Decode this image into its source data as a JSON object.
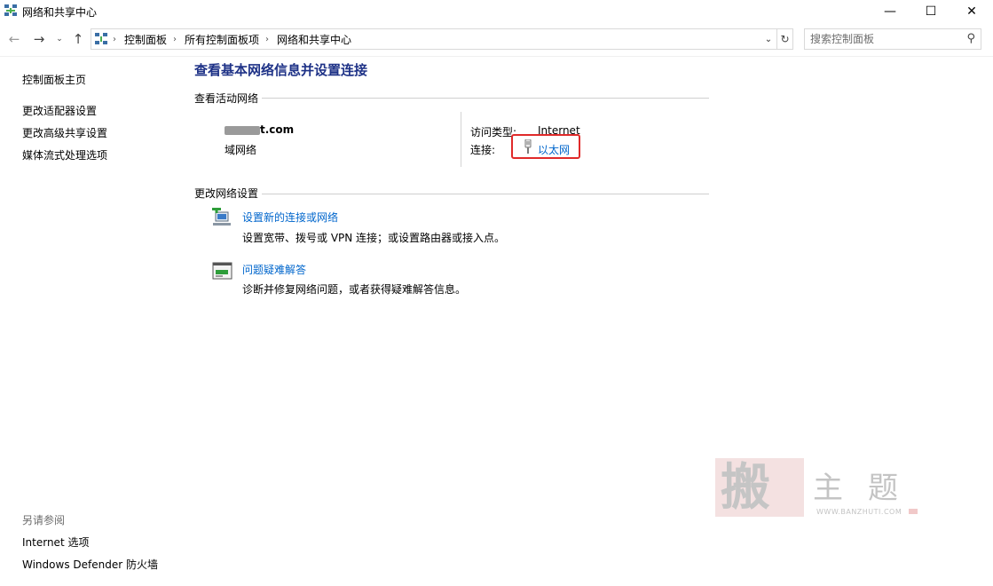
{
  "window": {
    "title": "网络和共享中心",
    "minimize_glyph": "—",
    "maximize_glyph": "☐",
    "close_glyph": "✕"
  },
  "addressbar": {
    "crumbs": [
      "控制面板",
      "所有控制面板项",
      "网络和共享中心"
    ],
    "search_placeholder": "搜索控制面板"
  },
  "leftnav": {
    "items": [
      {
        "label": "控制面板主页"
      },
      {
        "label": "更改适配器设置"
      },
      {
        "label": "更改高级共享设置"
      },
      {
        "label": "媒体流式处理选项"
      }
    ],
    "see_also_heading": "另请参阅",
    "see_also": [
      {
        "label": "Internet 选项"
      },
      {
        "label": "Windows Defender 防火墙"
      }
    ]
  },
  "main": {
    "title": "查看基本网络信息并设置连接",
    "active_networks_heading": "查看活动网络",
    "network": {
      "name_suffix": "t.com",
      "type": "域网络",
      "access_type_label": "访问类型:",
      "access_type_value": "Internet",
      "connections_label": "连接:",
      "connection_name": "以太网"
    },
    "change_settings_heading": "更改网络设置",
    "tasks": [
      {
        "title": "设置新的连接或网络",
        "description": "设置宽带、拨号或 VPN 连接；或设置路由器或接入点。",
        "icon": "new-connection-icon"
      },
      {
        "title": "问题疑难解答",
        "description": "诊断并修复网络问题，或者获得疑难解答信息。",
        "icon": "troubleshoot-icon"
      }
    ]
  },
  "watermark": {
    "seal_char": "搬",
    "text": "主题",
    "url": "WWW.BANZHUTI.COM"
  },
  "colors": {
    "title_blue": "#1e3287",
    "link_blue": "#0066cc",
    "highlight_red": "#e02a2a"
  }
}
